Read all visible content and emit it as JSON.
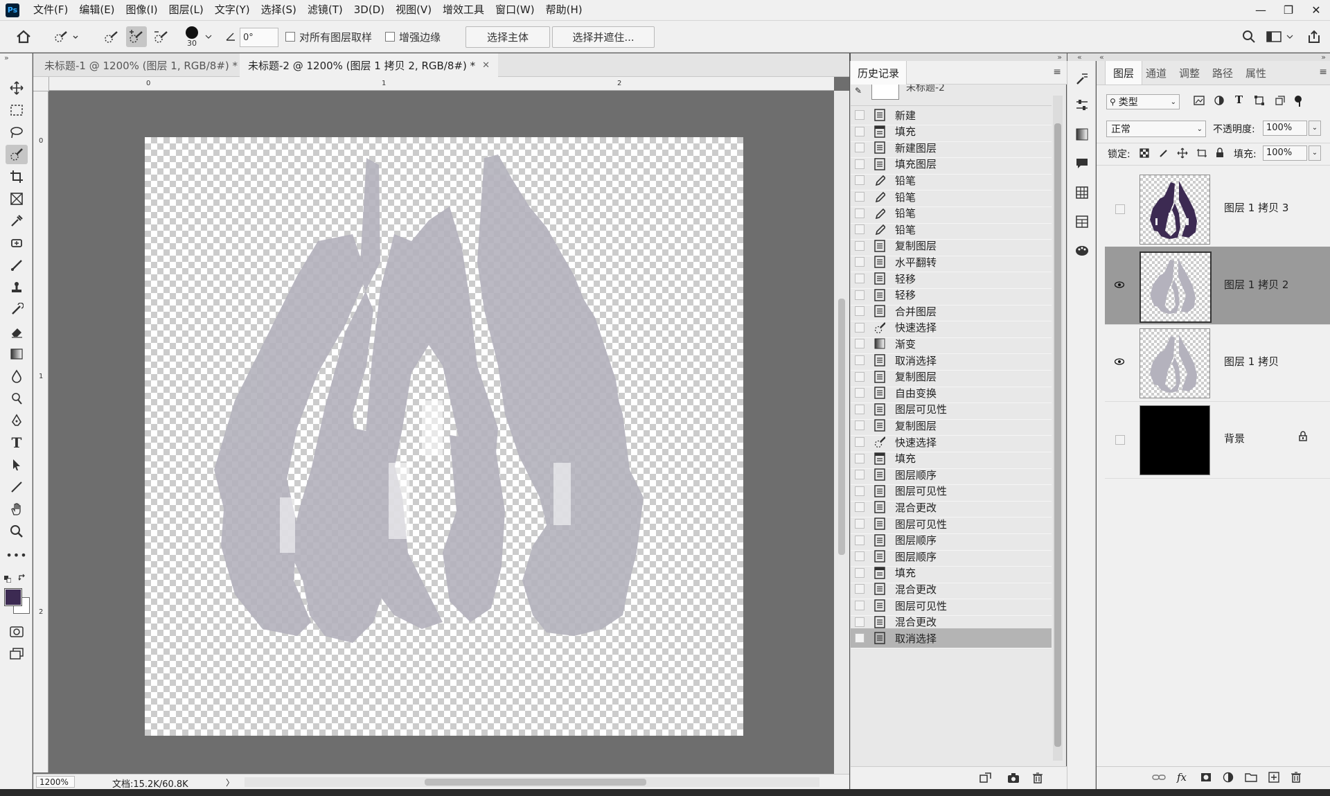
{
  "app": {
    "logo": "Ps"
  },
  "menu": [
    "文件(F)",
    "编辑(E)",
    "图像(I)",
    "图层(L)",
    "文字(Y)",
    "选择(S)",
    "滤镜(T)",
    "3D(D)",
    "视图(V)",
    "增效工具",
    "窗口(W)",
    "帮助(H)"
  ],
  "window_controls": {
    "minimize": "—",
    "restore": "❐",
    "close": "✕"
  },
  "options": {
    "brush_size": "30",
    "angle_value": "0°",
    "sample_all_layers_label": "对所有图层取样",
    "enhance_edge_label": "增强边缘",
    "select_subject_label": "选择主体",
    "select_and_mask_label": "选择并遮住..."
  },
  "tabs": [
    {
      "label": "未标题-1 @ 1200% (图层 1, RGB/8#) *",
      "active": false
    },
    {
      "label": "未标题-2 @ 1200% (图层 1 拷贝 2, RGB/8#) *",
      "active": true
    }
  ],
  "rulers": {
    "top": [
      "0",
      "1",
      "2"
    ],
    "left": [
      "0",
      "1",
      "2"
    ]
  },
  "status": {
    "zoom": "1200%",
    "doc_info": "文档:15.2K/60.8K",
    "arrow": "〉"
  },
  "colors": {
    "foreground": "#3c2a52",
    "background": "#ffffff",
    "shape_fill": "#b4b2bd"
  },
  "history": {
    "title": "历史记录",
    "snapshot": "未标题-2",
    "items": [
      {
        "label": "新建",
        "icon": "doc"
      },
      {
        "label": "填充",
        "icon": "fill"
      },
      {
        "label": "新建图层",
        "icon": "doc"
      },
      {
        "label": "填充图层",
        "icon": "doc"
      },
      {
        "label": "铅笔",
        "icon": "pencil"
      },
      {
        "label": "铅笔",
        "icon": "pencil"
      },
      {
        "label": "铅笔",
        "icon": "pencil"
      },
      {
        "label": "铅笔",
        "icon": "pencil"
      },
      {
        "label": "复制图层",
        "icon": "doc"
      },
      {
        "label": "水平翻转",
        "icon": "doc"
      },
      {
        "label": "轻移",
        "icon": "doc"
      },
      {
        "label": "轻移",
        "icon": "doc"
      },
      {
        "label": "合并图层",
        "icon": "doc"
      },
      {
        "label": "快速选择",
        "icon": "quick"
      },
      {
        "label": "渐变",
        "icon": "gradient"
      },
      {
        "label": "取消选择",
        "icon": "doc"
      },
      {
        "label": "复制图层",
        "icon": "doc"
      },
      {
        "label": "自由变换",
        "icon": "doc"
      },
      {
        "label": "图层可见性",
        "icon": "doc"
      },
      {
        "label": "复制图层",
        "icon": "doc"
      },
      {
        "label": "快速选择",
        "icon": "quick"
      },
      {
        "label": "填充",
        "icon": "fill"
      },
      {
        "label": "图层顺序",
        "icon": "doc"
      },
      {
        "label": "图层可见性",
        "icon": "doc"
      },
      {
        "label": "混合更改",
        "icon": "doc"
      },
      {
        "label": "图层可见性",
        "icon": "doc"
      },
      {
        "label": "图层顺序",
        "icon": "doc"
      },
      {
        "label": "图层顺序",
        "icon": "doc"
      },
      {
        "label": "填充",
        "icon": "fill"
      },
      {
        "label": "混合更改",
        "icon": "doc"
      },
      {
        "label": "图层可见性",
        "icon": "doc"
      },
      {
        "label": "混合更改",
        "icon": "doc"
      },
      {
        "label": "取消选择",
        "icon": "doc",
        "selected": true
      }
    ]
  },
  "layers_panel": {
    "tabs": [
      "图层",
      "通道",
      "调整",
      "路径",
      "属性"
    ],
    "filter_label": "类型",
    "blend_mode": "正常",
    "opacity_label": "不透明度:",
    "opacity_value": "100%",
    "lock_label": "锁定:",
    "fill_label": "填充:",
    "fill_value": "100%",
    "layers": [
      {
        "name": "图层 1 拷贝 3",
        "visible": false,
        "selected": false,
        "thumb": "dark"
      },
      {
        "name": "图层 1 拷贝 2",
        "visible": true,
        "selected": true,
        "thumb": "light"
      },
      {
        "name": "图层 1 拷贝",
        "visible": true,
        "selected": false,
        "thumb": "light"
      },
      {
        "name": "背景",
        "visible": false,
        "selected": false,
        "thumb": "black",
        "locked": true
      }
    ]
  }
}
